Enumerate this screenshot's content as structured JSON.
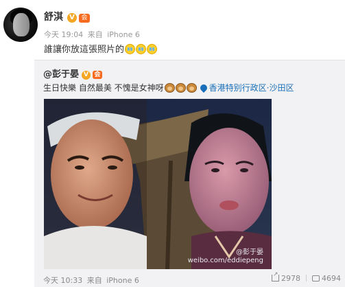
{
  "post": {
    "author": "舒淇",
    "verified_mark": "V",
    "member_mark": "会",
    "time": "今天 19:04",
    "from_label": "来自",
    "device": "iPhone 6",
    "text": "誰讓你放這張照片的"
  },
  "repost": {
    "author": "@彭于晏",
    "verified_mark": "V",
    "member_mark": "会",
    "text": "生日快樂 自然最美 不愧是女神呀",
    "location": "香港特别行政区·沙田区",
    "photo": {
      "watermark_handle": "@彭于晏",
      "watermark_url": "weibo.com/eddiepeng"
    },
    "time": "今天 10:33",
    "from_label": "来自",
    "device": "iPhone 6",
    "share_count": "2978",
    "comment_count": "4694"
  },
  "icons": [
    "verified-icon",
    "member-icon",
    "crying-emoji-icon",
    "monkey-emoji-icon",
    "location-pin-icon",
    "share-icon",
    "comment-icon"
  ]
}
